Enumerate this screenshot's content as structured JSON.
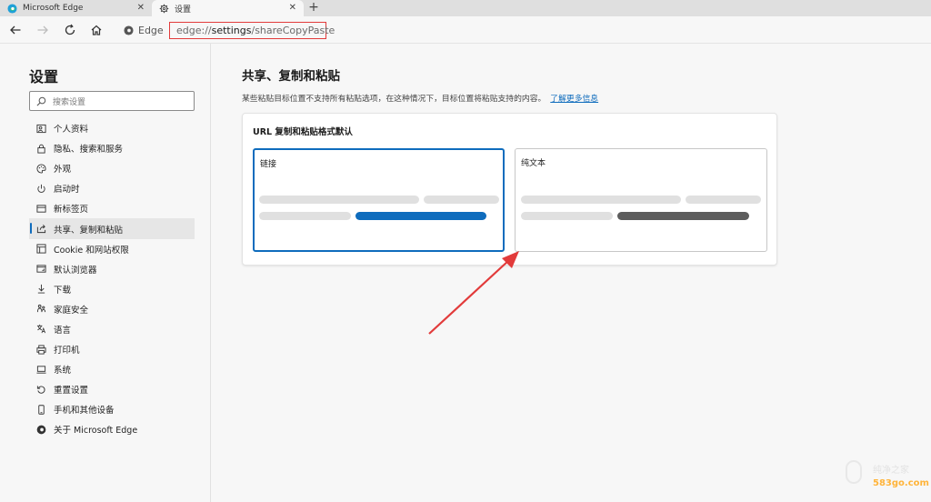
{
  "tabs": [
    {
      "title": "Microsoft Edge",
      "close_glyph": "✕"
    },
    {
      "title": "设置",
      "close_glyph": "✕"
    }
  ],
  "new_tab_glyph": "+",
  "toolbar": {
    "brand": "Edge",
    "url_prefix": "edge://",
    "url_host": "settings",
    "url_path": "/shareCopyPaste"
  },
  "sidebar": {
    "title": "设置",
    "search_placeholder": "搜索设置",
    "items": [
      {
        "label": "个人资料",
        "icon": "profile-icon"
      },
      {
        "label": "隐私、搜索和服务",
        "icon": "lock-icon"
      },
      {
        "label": "外观",
        "icon": "palette-icon"
      },
      {
        "label": "启动时",
        "icon": "power-icon"
      },
      {
        "label": "新标签页",
        "icon": "new-tab-icon"
      },
      {
        "label": "共享、复制和粘贴",
        "icon": "share-icon",
        "active": true
      },
      {
        "label": "Cookie 和网站权限",
        "icon": "site-permissions-icon"
      },
      {
        "label": "默认浏览器",
        "icon": "browser-icon"
      },
      {
        "label": "下载",
        "icon": "download-icon"
      },
      {
        "label": "家庭安全",
        "icon": "family-icon"
      },
      {
        "label": "语言",
        "icon": "language-icon"
      },
      {
        "label": "打印机",
        "icon": "printer-icon"
      },
      {
        "label": "系统",
        "icon": "system-icon"
      },
      {
        "label": "重置设置",
        "icon": "reset-icon"
      },
      {
        "label": "手机和其他设备",
        "icon": "phone-icon"
      },
      {
        "label": "关于 Microsoft Edge",
        "icon": "edge-logo-icon"
      }
    ]
  },
  "main": {
    "title": "共享、复制和粘贴",
    "description": "某些粘贴目标位置不支持所有粘贴选项，在这种情况下，目标位置将粘贴支持的内容。",
    "learn_more": "了解更多信息",
    "card_title": "URL 复制和粘贴格式默认",
    "options": [
      {
        "label": "链接",
        "selected": true
      },
      {
        "label": "纯文本",
        "selected": false
      }
    ]
  },
  "watermark": {
    "text": "纯净之家",
    "url": "583go.com"
  },
  "colors": {
    "accent": "#0f6cbd",
    "annotation_red": "#e23b3b",
    "watermark_orange": "#ffb43a"
  }
}
